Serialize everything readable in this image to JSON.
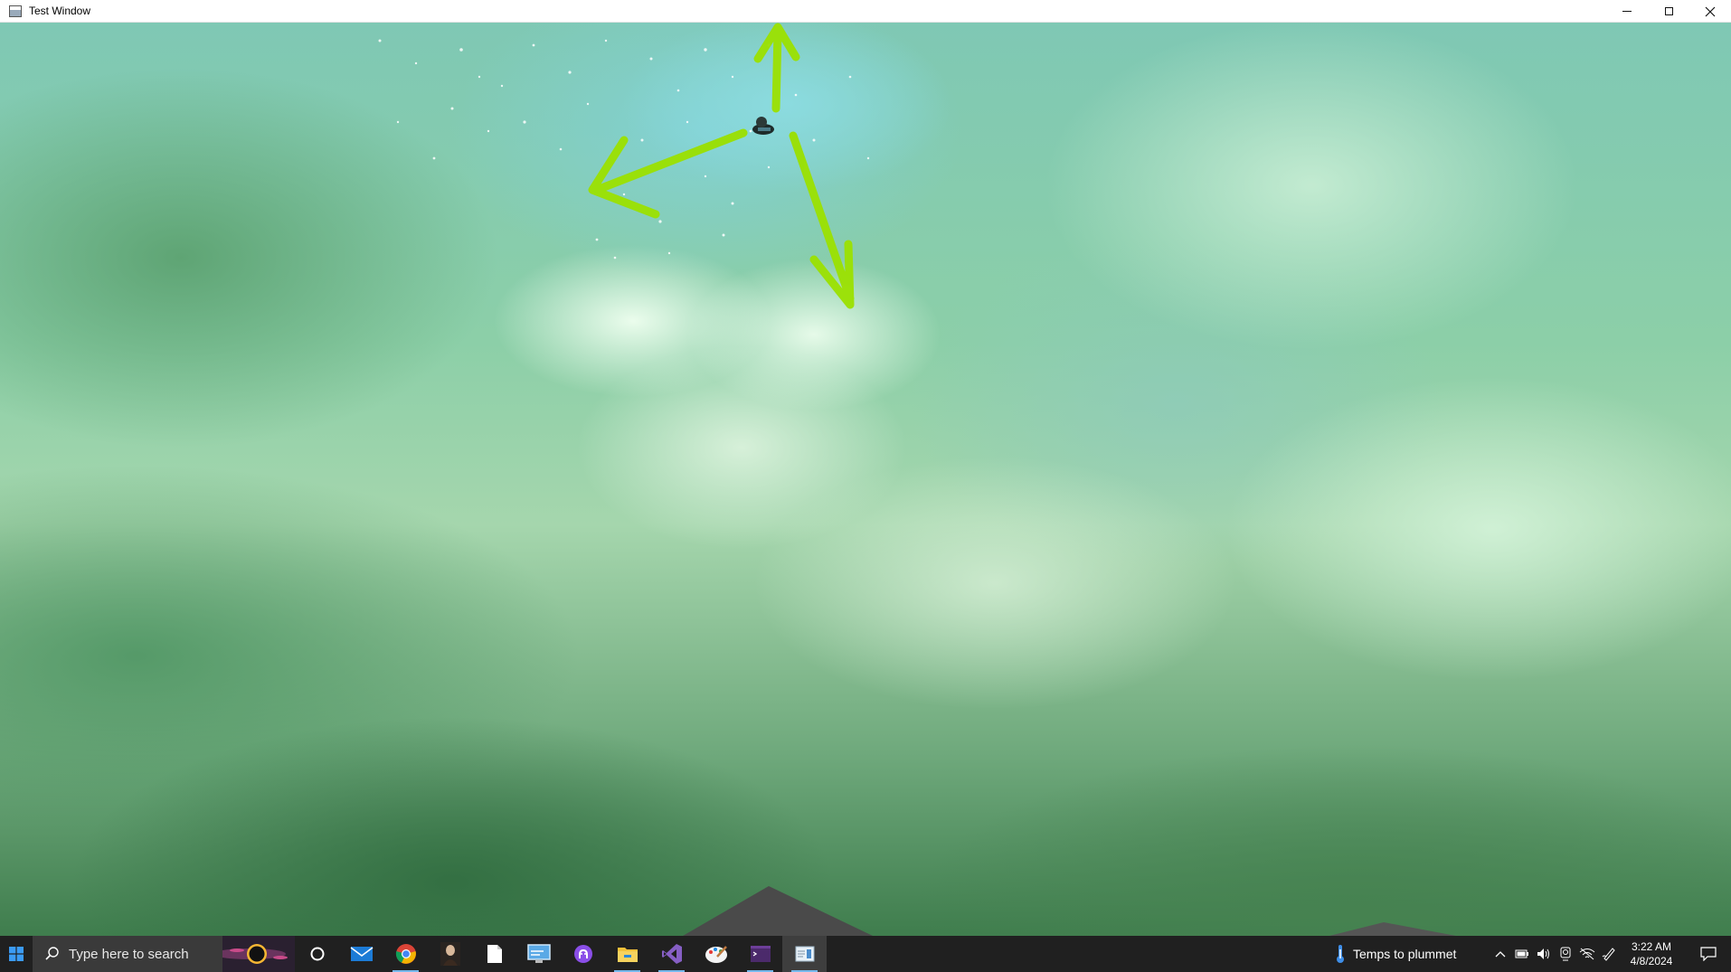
{
  "window": {
    "title": "Test Window",
    "controls": {
      "minimize": "minimize",
      "maximize": "maximize",
      "close": "close"
    }
  },
  "scene": {
    "annotation_color": "#9be000",
    "arrows": [
      "up",
      "down-left-left",
      "down-right"
    ]
  },
  "taskbar": {
    "search": {
      "placeholder": "Type here to search"
    },
    "apps": [
      {
        "name": "task-view",
        "icon": "cortana-circle-icon"
      },
      {
        "name": "mail",
        "icon": "mail-icon"
      },
      {
        "name": "chrome",
        "icon": "chrome-icon",
        "active": true
      },
      {
        "name": "portrait-app",
        "icon": "portrait-icon"
      },
      {
        "name": "notepad",
        "icon": "document-icon"
      },
      {
        "name": "remote-desktop",
        "icon": "remote-desktop-icon"
      },
      {
        "name": "github-desktop",
        "icon": "github-icon"
      },
      {
        "name": "file-explorer",
        "icon": "folder-icon",
        "active": true
      },
      {
        "name": "visual-studio",
        "icon": "visual-studio-icon",
        "active": true
      },
      {
        "name": "paint",
        "icon": "paint-icon"
      },
      {
        "name": "terminal",
        "icon": "terminal-icon",
        "active": true
      },
      {
        "name": "test-window",
        "icon": "window-icon",
        "active": true,
        "focused": true
      }
    ],
    "weather": {
      "label": "Temps to plummet"
    },
    "clock": {
      "time": "3:22 AM",
      "date": "4/8/2024"
    }
  }
}
